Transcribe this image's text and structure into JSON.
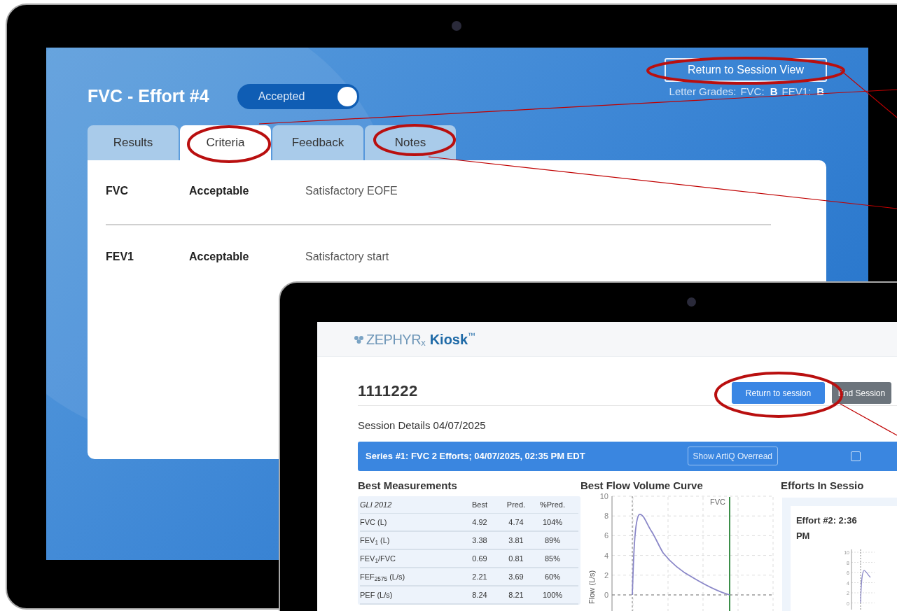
{
  "effort_screen": {
    "title": "FVC - Effort #4",
    "status_toggle": {
      "label": "Accepted",
      "on": true
    },
    "return_button": "Return to Session View",
    "letter_grades": {
      "label": "Letter Grades:",
      "items": [
        {
          "name": "FVC:",
          "grade": "B"
        },
        {
          "name": "FEV1:",
          "grade": "B"
        }
      ]
    },
    "tabs": [
      {
        "label": "Results",
        "selected": false
      },
      {
        "label": "Criteria",
        "selected": true
      },
      {
        "label": "Feedback",
        "selected": false
      },
      {
        "label": "Notes",
        "selected": false
      }
    ],
    "criteria": [
      {
        "measure": "FVC",
        "result": "Acceptable",
        "comment": "Satisfactory EOFE"
      },
      {
        "measure": "FEV1",
        "result": "Acceptable",
        "comment": "Satisfactory start"
      }
    ]
  },
  "session_screen": {
    "logo": {
      "brand": "ZEPHYR",
      "rx": "x",
      "product": "Kiosk",
      "tm": "™"
    },
    "title": "1111222",
    "buttons": [
      {
        "label": "Return to session",
        "kind": "primary"
      },
      {
        "label": "End Session",
        "kind": "secondary"
      }
    ],
    "subtitle": "Session Details 04/07/2025",
    "series": {
      "label": "Series #1: FVC 2 Efforts; 04/07/2025, 02:35 PM EDT",
      "overread_button": "Show ArtiQ Overread",
      "checked": false
    },
    "best_measurements": {
      "heading": "Best Measurements",
      "columns": [
        "GLI 2012",
        "Best",
        "Pred.",
        "%Pred."
      ],
      "rows": [
        [
          "FVC (L)",
          "4.92",
          "4.74",
          "104%"
        ],
        [
          "FEV$_{1}$ (L)",
          "3.38",
          "3.81",
          "89%"
        ],
        [
          "FEV$_{1}$/FVC",
          "0.69",
          "0.81",
          "85%"
        ],
        [
          "FEF$_{2575}$ (L/s)",
          "2.21",
          "3.69",
          "60%"
        ],
        [
          "PEF (L/s)",
          "8.24",
          "8.21",
          "100%"
        ]
      ]
    },
    "flow_curve": {
      "heading": "Best Flow Volume Curve",
      "ylabel": "Flow (L/s)",
      "yticks": [
        "10",
        "8",
        "6",
        "4",
        "2",
        "0"
      ],
      "marker": "FVC"
    },
    "efforts": {
      "heading": "Efforts In Sessio",
      "card_title": "Effort #2: 2:36 PM",
      "yticks": [
        "10",
        "8",
        "6",
        "4",
        "2",
        "0"
      ]
    }
  }
}
